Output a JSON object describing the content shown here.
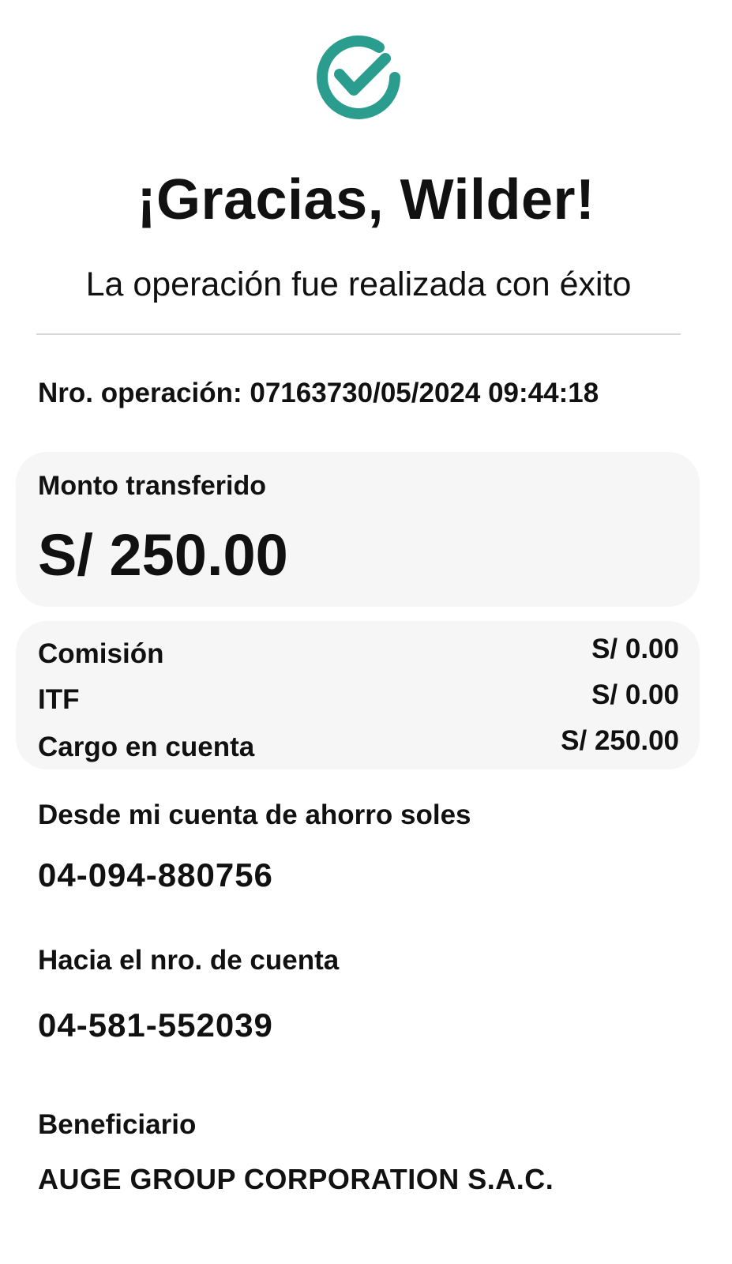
{
  "colors": {
    "accent": "#2a9d8f",
    "card_background": "#f6f6f6",
    "divider": "#d9d9d9",
    "text": "#111111"
  },
  "header": {
    "icon": "check-circle-icon",
    "title": "¡Gracias, Wilder!",
    "subtitle": "La operación fue realizada con éxito"
  },
  "operation": {
    "label": "Nro. operación: ",
    "number": "071637",
    "datetime": "30/05/2024 09:44:18"
  },
  "amount": {
    "label": "Monto transferido",
    "value": "S/ 250.00"
  },
  "fees": [
    {
      "label": "Comisión",
      "value": "S/ 0.00"
    },
    {
      "label": "ITF",
      "value": "S/ 0.00"
    },
    {
      "label": "Cargo en cuenta",
      "value": "S/ 250.00"
    }
  ],
  "from": {
    "label": "Desde mi cuenta de ahorro soles",
    "account": "04-094-880756"
  },
  "to": {
    "label": "Hacia el nro. de cuenta",
    "account": "04-581-552039"
  },
  "beneficiary": {
    "label": "Beneficiario",
    "name": "AUGE GROUP CORPORATION S.A.C."
  }
}
